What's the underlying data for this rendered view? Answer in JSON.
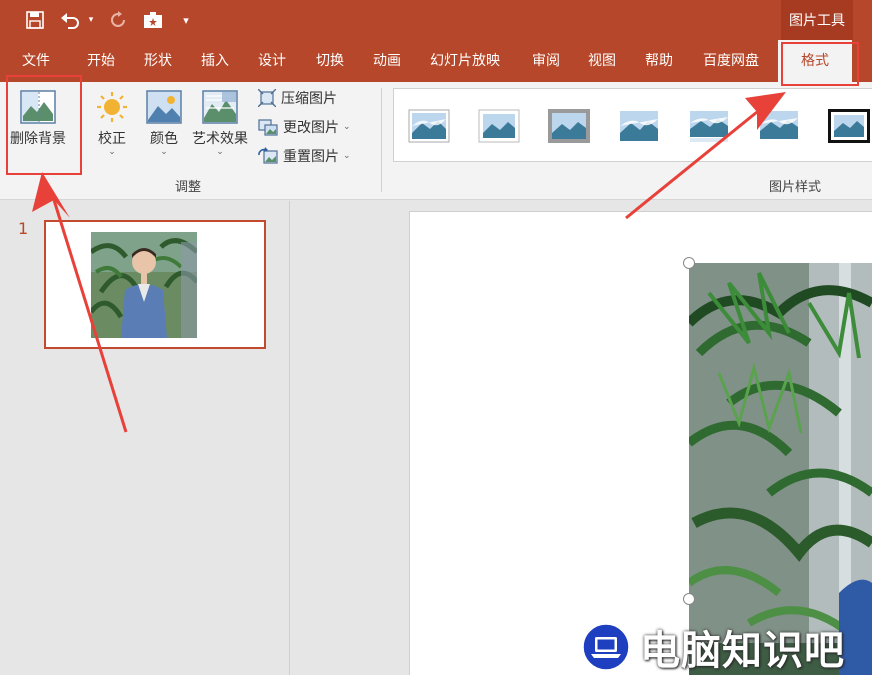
{
  "quick_access": {
    "save_icon": "save-icon",
    "undo_icon": "undo-icon",
    "redo_icon": "redo-icon",
    "present_icon": "present-from-beginning-icon",
    "customize_icon": "customize-qat-icon"
  },
  "context_tab": "图片工具",
  "tabs": [
    "文件",
    "开始",
    "形状",
    "插入",
    "设计",
    "切换",
    "动画",
    "幻灯片放映",
    "审阅",
    "视图",
    "帮助",
    "百度网盘",
    "格式"
  ],
  "active_tab": "格式",
  "ribbon": {
    "adjust_group": {
      "remove_bg": "删除背景",
      "corrections": "校正",
      "color": "颜色",
      "artistic": "艺术效果",
      "compress": "压缩图片",
      "change": "更改图片",
      "reset": "重置图片",
      "label": "调整"
    },
    "styles_group": {
      "label": "图片样式"
    }
  },
  "slides": {
    "current_number": "1"
  },
  "watermark": "电脑知识吧",
  "colors": {
    "accent": "#b7472a",
    "annotation": "#e8413a"
  }
}
